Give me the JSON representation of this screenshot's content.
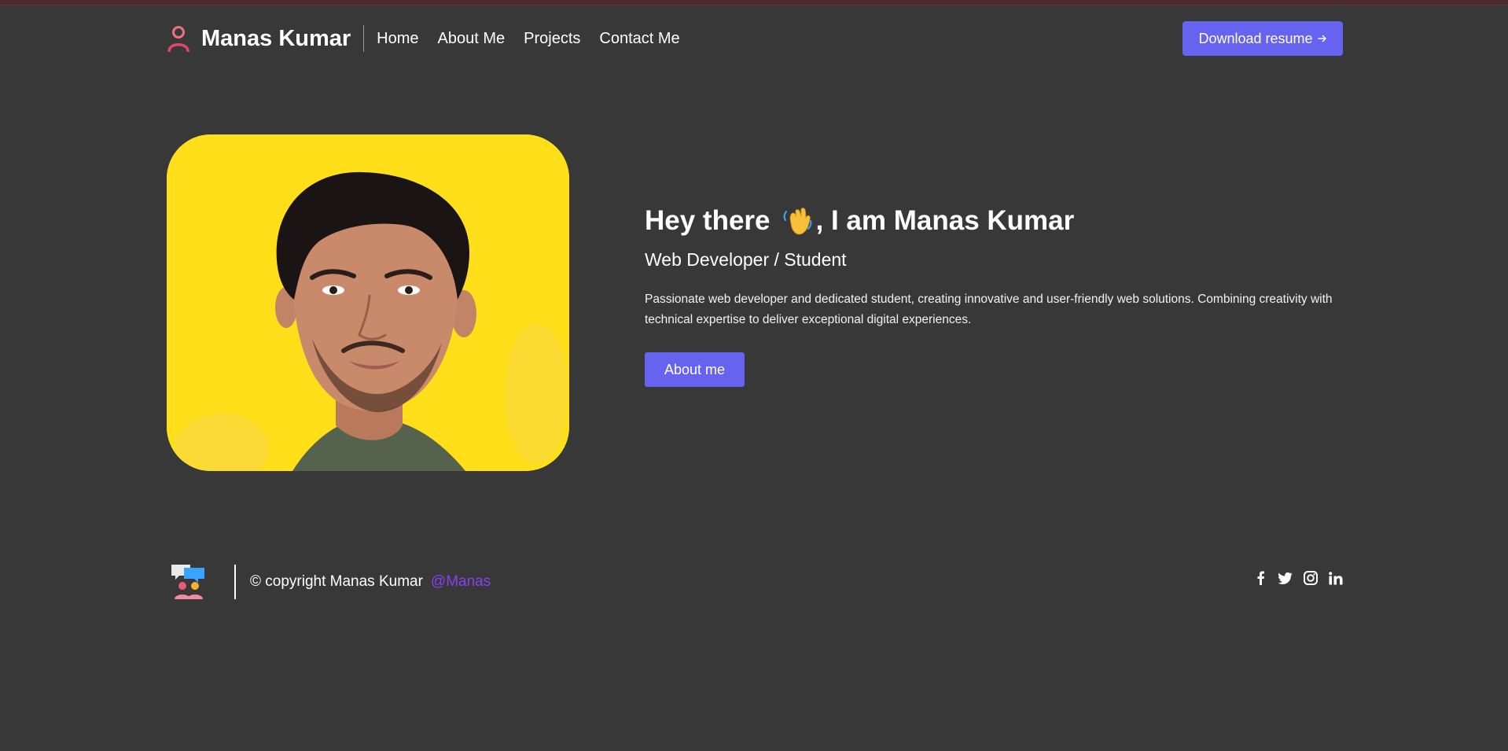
{
  "header": {
    "brand_name": "Manas Kumar",
    "brand_icon": "user-icon",
    "nav": [
      {
        "label": "Home"
      },
      {
        "label": "About Me"
      },
      {
        "label": "Projects"
      },
      {
        "label": "Contact Me"
      }
    ],
    "download_label": "Download resume",
    "download_icon": "arrow-right-icon"
  },
  "hero": {
    "title_before": "Hey there",
    "title_icon": "waving-hand-icon",
    "title_after": ", I am Manas Kumar",
    "subtitle": "Web Developer / Student",
    "description": "Passionate web developer and dedicated student, creating innovative and user-friendly web solutions. Combining creativity with technical expertise to deliver exceptional digital experiences.",
    "cta_label": "About me",
    "photo_icon": "profile-photo"
  },
  "footer": {
    "logo_icon": "chat-people-icon",
    "copyright": "© copyright Manas Kumar",
    "handle": "@Manas",
    "socials": [
      "facebook-icon",
      "twitter-icon",
      "instagram-icon",
      "linkedin-icon"
    ]
  },
  "colors": {
    "background": "#383838",
    "accent": "#6563f0",
    "handle": "#8a3ff0",
    "photo_bg": "#ffdf1a"
  }
}
